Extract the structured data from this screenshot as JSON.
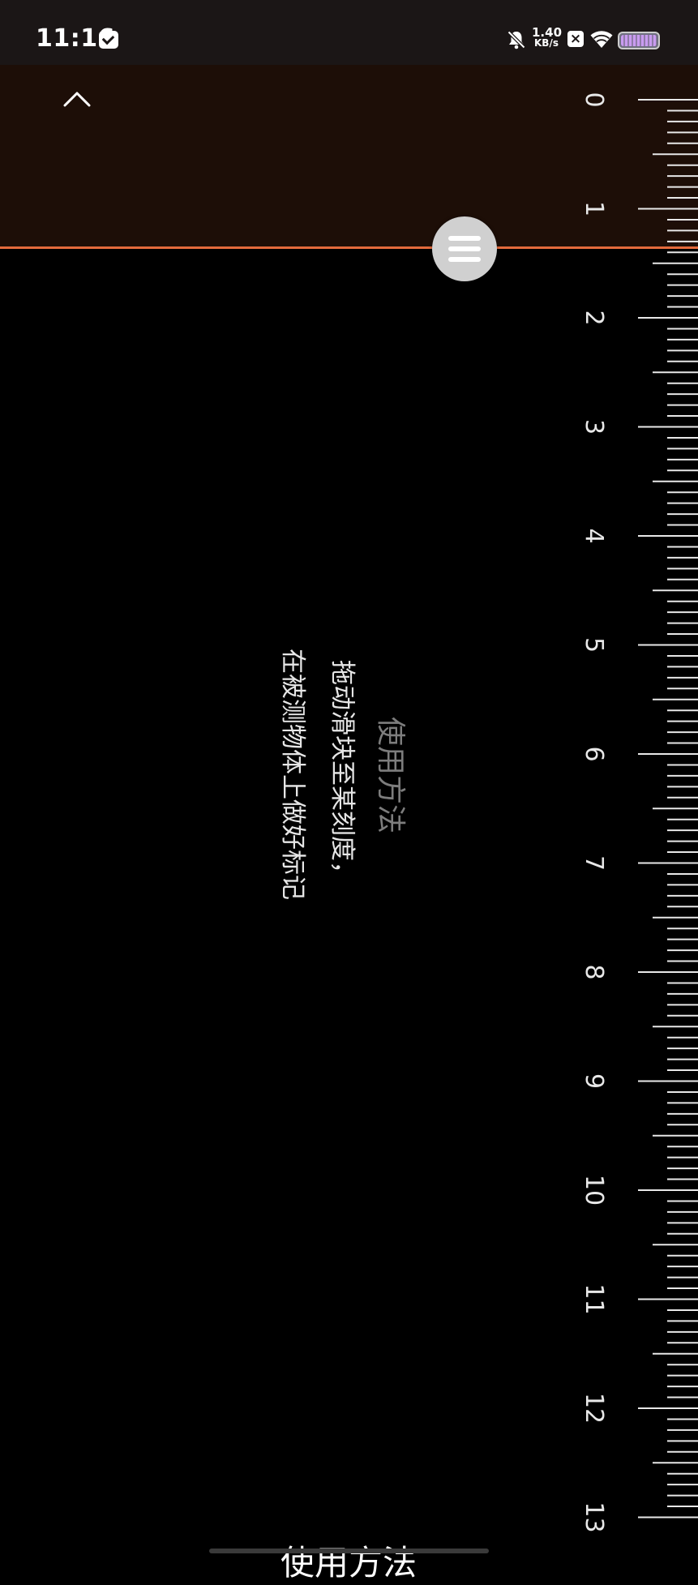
{
  "status_bar": {
    "time": "11:16",
    "net_speed_value": "1.40",
    "net_speed_unit": "KB/s",
    "notification_icons": [
      "mail-icon"
    ],
    "system_icons": [
      "bell-muted-icon",
      "close-box-icon",
      "wifi-icon",
      "battery-icon"
    ],
    "close_box_glyph": "×"
  },
  "ruler": {
    "unit": "cm",
    "labels": [
      "0",
      "1",
      "2",
      "3",
      "4",
      "5",
      "6",
      "7",
      "8",
      "9",
      "10",
      "11",
      "12",
      "13"
    ],
    "slider_value": 1.35,
    "accent_color": "#e46a3c",
    "measured_region_color": "#1d0e07"
  },
  "instructions": {
    "title": "使用方法",
    "line1": "拖动滑块至某刻度，",
    "line2": "在被测物体上做好标记"
  },
  "footer": {
    "title": "使用方法"
  }
}
